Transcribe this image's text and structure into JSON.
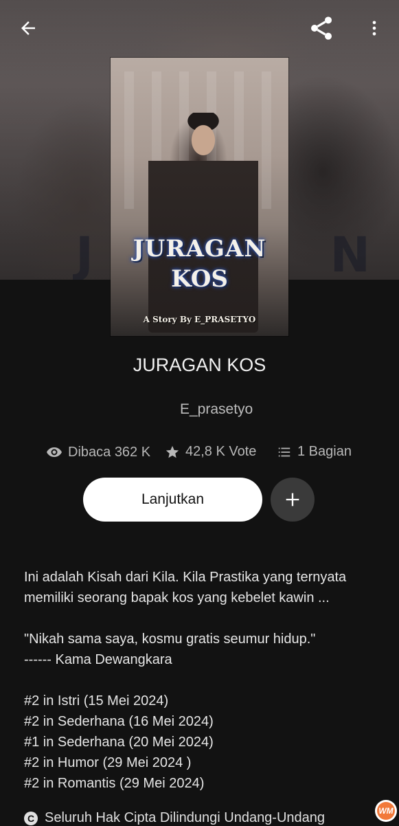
{
  "story": {
    "title": "JURAGAN KOS",
    "author": "E_prasetyo",
    "cover": {
      "title_line1": "JURAGAN",
      "title_line2": "KOS",
      "byline": "A Story By E_PRASETYO"
    }
  },
  "topbar": {
    "icons": [
      "arrow-back-icon",
      "share-icon",
      "more-vert-icon"
    ]
  },
  "stats": {
    "reads": "Dibaca 362 K",
    "votes": "42,8 K Vote",
    "parts": "1 Bagian",
    "icons": [
      "eye-icon",
      "star-icon",
      "list-icon"
    ]
  },
  "actions": {
    "continue_label": "Lanjutkan",
    "add_icon": "plus-icon"
  },
  "description": {
    "synopsis_line1": "Ini adalah Kisah dari Kila. Kila Prastika yang ternyata",
    "synopsis_line2": "memiliki seorang bapak kos yang kebelet kawin ...",
    "quote_line1": "\"Nikah sama saya, kosmu gratis seumur hidup.\"",
    "quote_line2": "------ Kama Dewangkara",
    "rankings": [
      "#2 in Istri (15 Mei 2024)",
      "#2 in Sederhana (16 Mei 2024)",
      "#1 in Sederhana (20 Mei 2024)",
      "#2 in Humor (29 Mei 2024 )",
      "#2 in Romantis (29 Mei 2024)"
    ]
  },
  "footer": {
    "copyright": "Seluruh Hak Cipta Dilindungi Undang-Undang",
    "copyright_icon": "copyright-icon"
  },
  "watermark": {
    "text": "WM"
  },
  "colors": {
    "background": "#121212",
    "button_primary": "#ffffff",
    "button_secondary": "#3a3a3a",
    "watermark_orange": "#f2793a"
  }
}
